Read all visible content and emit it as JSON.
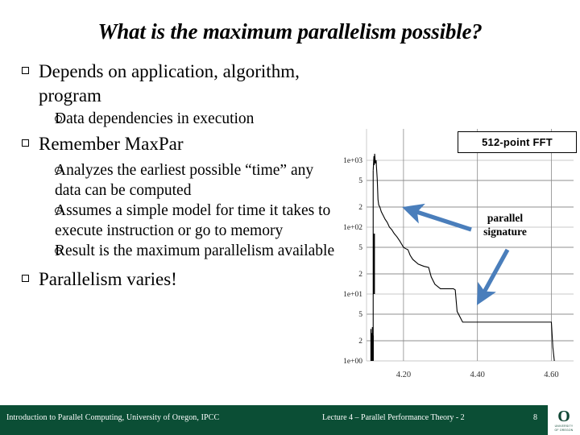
{
  "slide": {
    "title": "What is the maximum parallelism possible?",
    "page_number": "8"
  },
  "bullets": [
    {
      "level": 1,
      "text": "Depends on application, algorithm, program"
    },
    {
      "level": 2,
      "text": "Data dependencies in execution"
    },
    {
      "level": 1,
      "text": "Remember MaxPar"
    },
    {
      "level": 2,
      "text": "Analyzes the earliest possible “time” any data can be computed"
    },
    {
      "level": 2,
      "text": "Assumes a simple model for time it takes to execute instruction or go to memory"
    },
    {
      "level": 2,
      "text": "Result is the maximum parallelism available"
    },
    {
      "level": 1,
      "text": "Parallelism varies!"
    }
  ],
  "annotations": {
    "fft_label": "512-point FFT",
    "signature_line1": "parallel",
    "signature_line2": "signature",
    "arrow_color": "#4a7ebb"
  },
  "footer": {
    "left": "Introduction to Parallel Computing, University of Oregon, IPCC",
    "center": "Lecture 4 – Parallel Performance Theory - 2",
    "bar_color": "#0b4e35",
    "logo_letter": "O",
    "logo_line1": "UNIVERSITY",
    "logo_line2": "OF OREGON"
  },
  "chart_data": {
    "type": "line",
    "title": "512-point FFT",
    "xlabel": "",
    "ylabel": "",
    "yscale": "log",
    "xlim": [
      4.1,
      4.66
    ],
    "ylim": [
      1,
      2000
    ],
    "grid": true,
    "legend": "none",
    "ytick_labels": [
      "1e+03",
      "5",
      "2",
      "1e+02",
      "5",
      "2",
      "1e+01",
      "5",
      "2",
      "1e+00"
    ],
    "ytick_values": [
      1000,
      500,
      200,
      100,
      50,
      20,
      10,
      5,
      2,
      1
    ],
    "xtick_labels": [
      "4.20",
      "4.40",
      "4.60"
    ],
    "xtick_values": [
      4.2,
      4.4,
      4.6
    ],
    "series": [
      {
        "name": "parallel signature",
        "x": [
          4.118,
          4.12,
          4.121,
          4.122,
          4.124,
          4.126,
          4.127,
          4.129,
          4.131,
          4.133,
          4.136,
          4.14,
          4.145,
          4.15,
          4.156,
          4.162,
          4.168,
          4.175,
          4.182,
          4.19,
          4.2,
          4.205,
          4.212,
          4.218,
          4.225,
          4.24,
          4.255,
          4.268,
          4.275,
          4.285,
          4.3,
          4.32,
          4.335,
          4.34,
          4.345,
          4.36,
          4.4,
          4.45,
          4.5,
          4.56,
          4.6,
          4.604,
          4.608
        ],
        "y": [
          700,
          1150,
          850,
          1250,
          900,
          1000,
          780,
          520,
          260,
          215,
          200,
          170,
          150,
          132,
          118,
          100,
          92,
          80,
          72,
          62,
          50,
          48,
          46,
          38,
          33,
          28,
          26,
          25,
          18,
          14,
          12,
          12,
          12,
          11.5,
          5.5,
          3.8,
          3.8,
          3.8,
          3.8,
          3.8,
          3.8,
          1.6,
          1.0
        ]
      }
    ],
    "noise_spikes_x": [
      4.112,
      4.114,
      4.116,
      4.118
    ],
    "annotations": [
      {
        "text": "parallel signature",
        "pointer": "down-left-and-left-arrows"
      }
    ]
  }
}
